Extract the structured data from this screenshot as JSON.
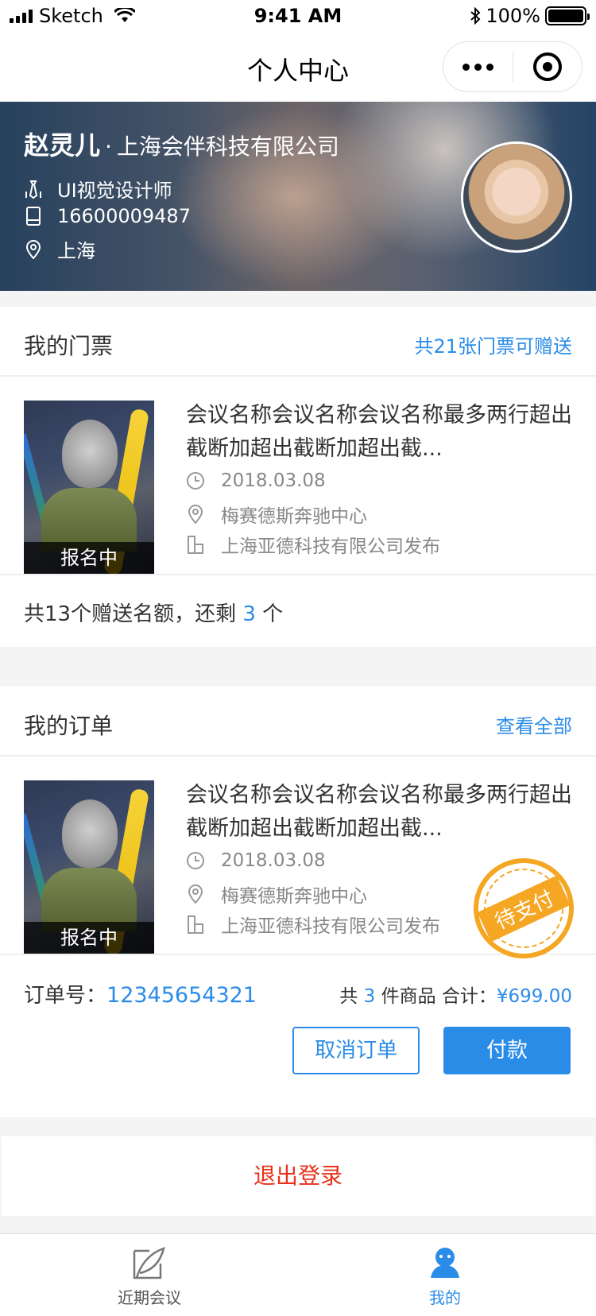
{
  "status_bar": {
    "carrier": "Sketch",
    "time": "9:41 AM",
    "battery": "100%"
  },
  "nav": {
    "title": "个人中心"
  },
  "profile": {
    "name": "赵灵儿",
    "separator": "·",
    "company": "上海会伴科技有限公司",
    "job": "UI视觉设计师",
    "phone": "16600009487",
    "city": "上海"
  },
  "tickets": {
    "title": "我的门票",
    "link": "共21张门票可赠送",
    "item": {
      "badge": "报名中",
      "title": "会议名称会议名称会议名称最多两行超出截断加超出截断加超出截...",
      "date": "2018.03.08",
      "venue": "梅赛德斯奔驰中心",
      "publisher": "上海亚德科技有限公司发布"
    },
    "quota_prefix": "共13个赠送名额，还剩",
    "quota_remaining": "3",
    "quota_suffix": "个"
  },
  "orders": {
    "title": "我的订单",
    "link": "查看全部",
    "item": {
      "badge": "报名中",
      "title": "会议名称会议名称会议名称最多两行超出截断加超出截断加超出截...",
      "date": "2018.03.08",
      "venue": "梅赛德斯奔驰中心",
      "publisher": "上海亚德科技有限公司发布",
      "stamp": "待支付"
    },
    "order_no_label": "订单号：",
    "order_no": "12345654321",
    "count_prefix": "共",
    "count": "3",
    "count_suffix": "件商品  合计：",
    "total": "¥699.00",
    "cancel_label": "取消订单",
    "pay_label": "付款"
  },
  "logout_label": "退出登录",
  "tabbar": {
    "tabs": [
      {
        "label": "近期会议",
        "icon": "feather-icon",
        "active": false
      },
      {
        "label": "我的",
        "icon": "user-icon",
        "active": true
      }
    ]
  },
  "colors": {
    "accent": "#2b8ce8",
    "danger": "#e8311a",
    "stamp": "#f5a623"
  }
}
